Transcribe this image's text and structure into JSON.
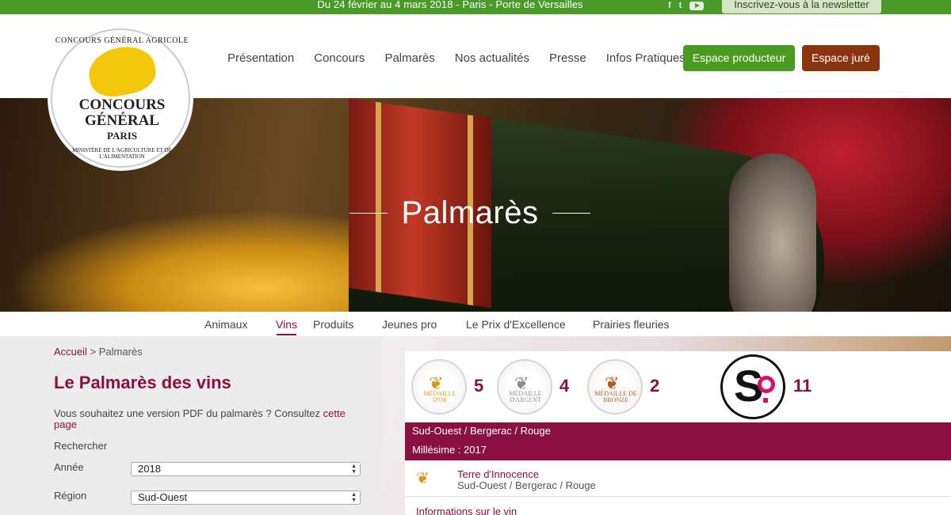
{
  "topbar": {
    "dates": "Du 24 février au 4 mars 2018 - Paris - Porte de Versailles",
    "social": {
      "facebook": "f",
      "twitter": "t",
      "youtube_icon": "youtube-icon"
    },
    "newsletter": "Inscrivez-vous à la newsletter"
  },
  "logo": {
    "top_arc": "CONCOURS GÉNÉRAL AGRICOLE",
    "line1": "CONCOURS",
    "line2": "GÉNÉRAL",
    "line3": "PARIS",
    "bottom_arc": "MINISTÈRE DE L'AGRICULTURE ET DE L'ALIMENTATION"
  },
  "nav": {
    "items": [
      "Présentation",
      "Concours",
      "Palmarès",
      "Nos actualités",
      "Presse",
      "Infos Pratiques"
    ],
    "btn_producteur": "Espace producteur",
    "btn_jure": "Espace juré"
  },
  "hero": {
    "title": "Palmarès"
  },
  "subnav": {
    "items": [
      "Animaux",
      "Vins",
      "Produits",
      "Jeunes pro",
      "Le Prix d'Excellence",
      "Prairies fleuries"
    ],
    "active": "Vins"
  },
  "breadcrumb": {
    "home": "Accueil",
    "sep": " > ",
    "current": "Palmarès"
  },
  "left": {
    "title": "Le Palmarès des vins",
    "pdf_text": "Vous souhaitez une version PDF du palmarès ? Consultez ",
    "pdf_link": "cette page",
    "search_label": "Rechercher",
    "year_label": "Année",
    "year_value": "2018",
    "region_label": "Région",
    "region_value": "Sud-Ouest"
  },
  "medals": {
    "gold": {
      "label": "MÉDAILLE D'OR",
      "count": "5",
      "color": "#d49a1a"
    },
    "silver": {
      "label": "MÉDAILLE D'ARGENT",
      "count": "4",
      "color": "#8a8a8a"
    },
    "bronze": {
      "label": "MÉDAILLE DE BRONZE",
      "count": "2",
      "color": "#b55a1a"
    },
    "so": {
      "count": "11"
    }
  },
  "results": {
    "appellation": "Sud-Ouest / Bergerac / Rouge",
    "millesime": "Millésime : 2017",
    "wine_name": "Terre d'Innocence",
    "wine_region": "Sud-Ouest / Bergerac / Rouge",
    "info_link": "Informations sur le vin"
  },
  "colors": {
    "brand_green": "#4a9a2a",
    "brand_wine": "#8a1040",
    "jury_brown": "#8a3510"
  }
}
